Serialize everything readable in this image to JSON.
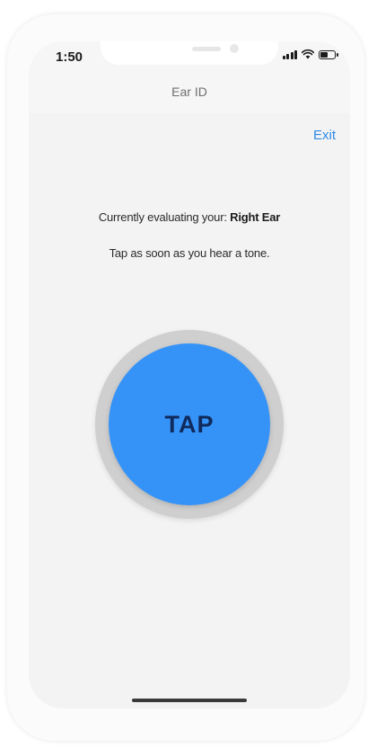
{
  "status_bar": {
    "time": "1:50",
    "battery_level": 0.5
  },
  "nav": {
    "title": "Ear ID",
    "exit_label": "Exit"
  },
  "evaluation": {
    "prefix": "Currently evaluating your: ",
    "ear": "Right Ear",
    "instruction": "Tap as soon as you hear a tone."
  },
  "tap_button": {
    "label": "TAP"
  },
  "colors": {
    "accent": "#2f8ce6",
    "tap_fill": "#3593f8",
    "tap_ring": "#cfcfcf",
    "tap_text": "#112a5c",
    "background": "#f3f3f3"
  },
  "icons": [
    "signal-icon",
    "wifi-icon",
    "battery-icon"
  ]
}
